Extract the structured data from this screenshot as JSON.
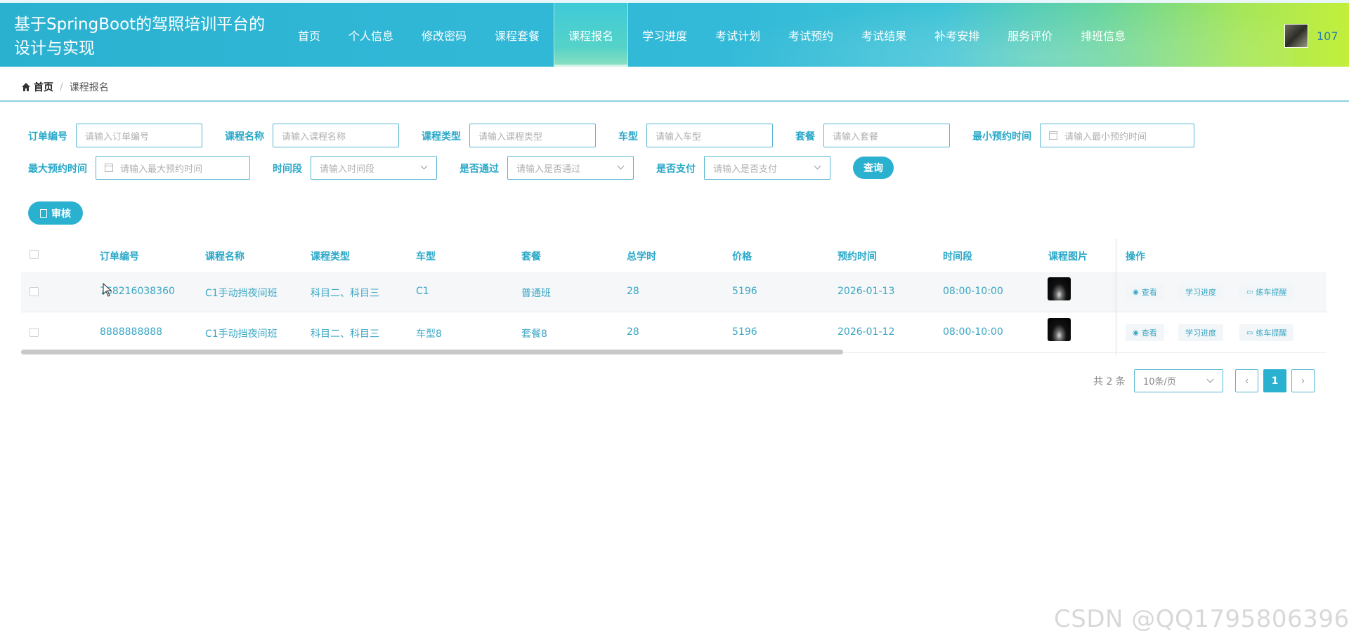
{
  "header": {
    "title": "基于SpringBoot的驾照培训平台的设计与实现",
    "nav": [
      "首页",
      "个人信息",
      "修改密码",
      "课程套餐",
      "课程报名",
      "学习进度",
      "考试计划",
      "考试预约",
      "考试结果",
      "补考安排",
      "服务评价",
      "排班信息"
    ],
    "active_nav": "课程报名",
    "username": "107"
  },
  "breadcrumb": {
    "home": "首页",
    "separator": "/",
    "current": "课程报名"
  },
  "filters": {
    "order_no": {
      "label": "订单编号",
      "placeholder": "请输入订单编号"
    },
    "course_name": {
      "label": "课程名称",
      "placeholder": "请输入课程名称"
    },
    "course_type": {
      "label": "课程类型",
      "placeholder": "请输入课程类型"
    },
    "car_type": {
      "label": "车型",
      "placeholder": "请输入车型"
    },
    "package": {
      "label": "套餐",
      "placeholder": "请输入套餐"
    },
    "min_time": {
      "label": "最小预约时间",
      "placeholder": "请输入最小预约时间"
    },
    "max_time": {
      "label": "最大预约时间",
      "placeholder": "请输入最大预约时间"
    },
    "time_slot": {
      "label": "时间段",
      "placeholder": "请输入时间段"
    },
    "passed": {
      "label": "是否通过",
      "placeholder": "请输入是否通过"
    },
    "paid": {
      "label": "是否支付",
      "placeholder": "请输入是否支付"
    },
    "query_label": "查询"
  },
  "actions": {
    "audit_label": "审核"
  },
  "table": {
    "columns": [
      "订单编号",
      "课程名称",
      "课程类型",
      "车型",
      "套餐",
      "总学时",
      "价格",
      "预约时间",
      "时间段",
      "课程图片",
      "操作"
    ],
    "rows": [
      {
        "order_no": "768216038360",
        "course_name": "C1手动挡夜间班",
        "course_type": "科目二、科目三",
        "car_type": "C1",
        "package": "普通班",
        "hours": "28",
        "price": "5196",
        "time": "2026-01-13",
        "slot": "08:00-10:00"
      },
      {
        "order_no": "8888888888",
        "course_name": "C1手动挡夜间班",
        "course_type": "科目二、科目三",
        "car_type": "车型8",
        "package": "套餐8",
        "hours": "28",
        "price": "5196",
        "time": "2026-01-12",
        "slot": "08:00-10:00"
      }
    ],
    "row_actions": {
      "view": "查看",
      "progress": "学习进度",
      "remind": "练车提醒"
    }
  },
  "pagination": {
    "total": "共 2 条",
    "page_size": "10条/页",
    "current_page": "1"
  },
  "watermark": "CSDN @QQ1795806396",
  "colors": {
    "accent": "#2bb1d0",
    "header_end": "#c2ef3b"
  }
}
